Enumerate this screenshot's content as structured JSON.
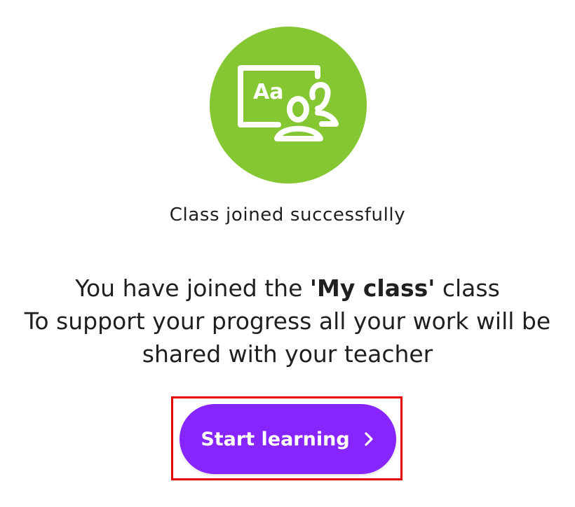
{
  "status": {
    "title": "Class joined successfully"
  },
  "message": {
    "prefix": "You have joined the ",
    "class_name": "'My class'",
    "suffix": " class",
    "line2": "To support your progress all your work will be",
    "line3": "shared with your teacher"
  },
  "cta": {
    "label": "Start learning",
    "icon": "chevron-right-icon"
  },
  "hero": {
    "icon": "classroom-icon",
    "icon_text": "Aa",
    "circle_color": "#84c733"
  },
  "colors": {
    "button": "#8725ff",
    "highlight": "#e60000",
    "text": "#1f1f1f"
  }
}
